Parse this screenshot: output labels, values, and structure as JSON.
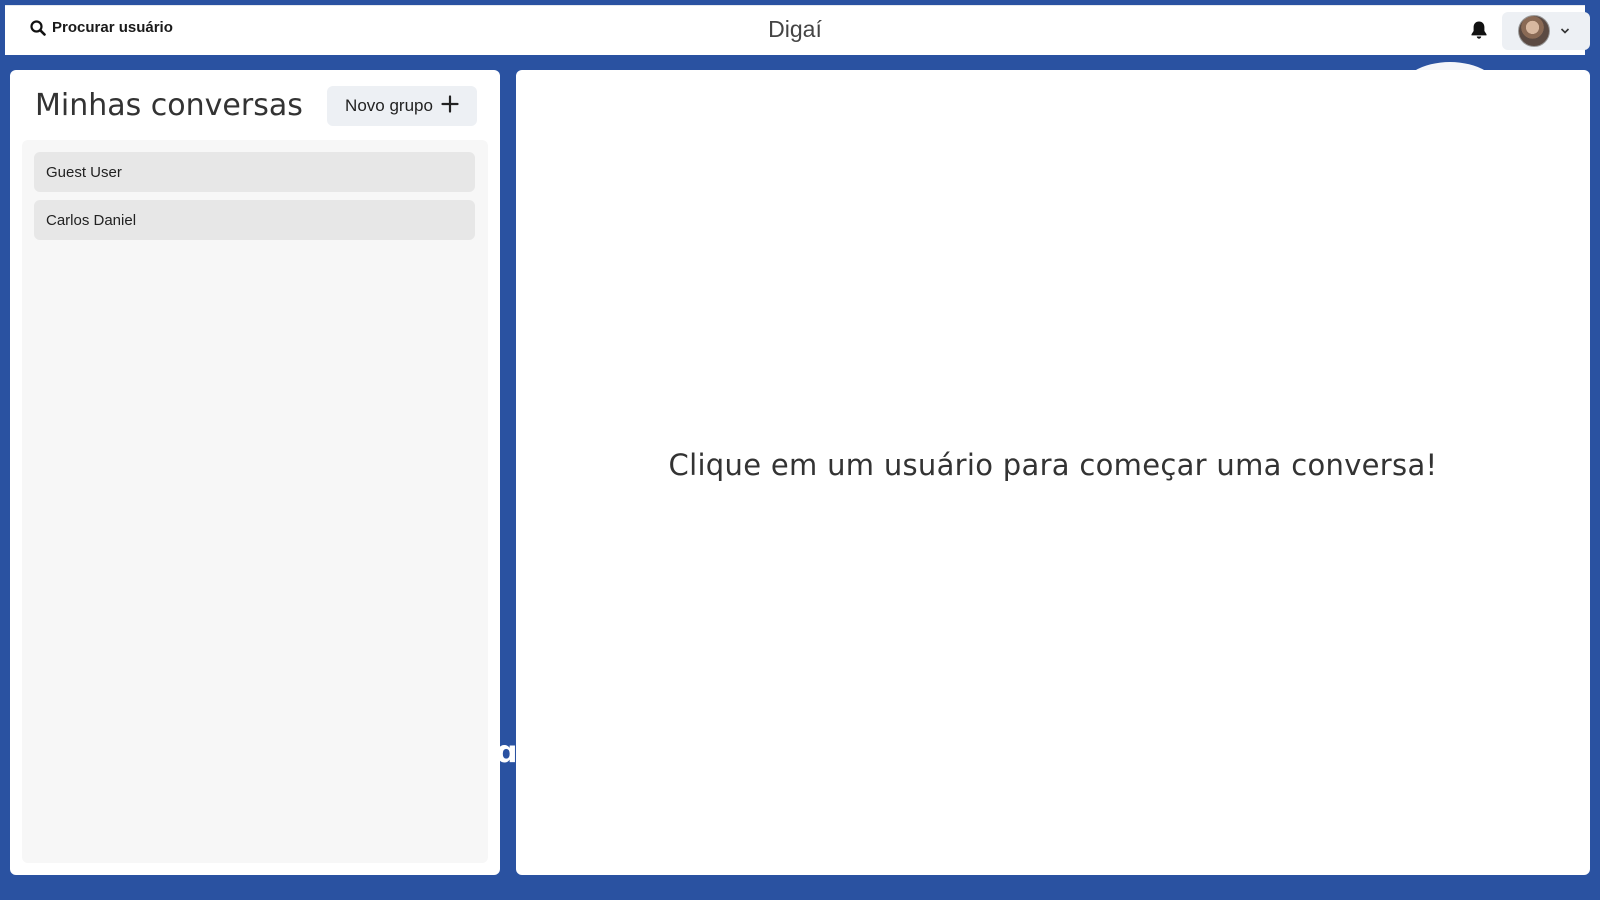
{
  "header": {
    "search_label": "Procurar usuário",
    "app_title": "Digaí"
  },
  "sidebar": {
    "title": "Minhas conversas",
    "new_group_label": "Novo grupo",
    "conversations": [
      {
        "name": "Guest User"
      },
      {
        "name": "Carlos Daniel"
      }
    ]
  },
  "main": {
    "empty_message": "Clique em um usuário para começar uma conversa!"
  },
  "colors": {
    "background": "#2a52a1",
    "panel": "#ffffff",
    "button_bg": "#edf0f4",
    "list_item_bg": "#e7e7e7"
  },
  "icons": {
    "search": "search-icon",
    "bell": "bell-icon",
    "plus": "plus-icon",
    "chevron": "chevron-down-icon"
  }
}
